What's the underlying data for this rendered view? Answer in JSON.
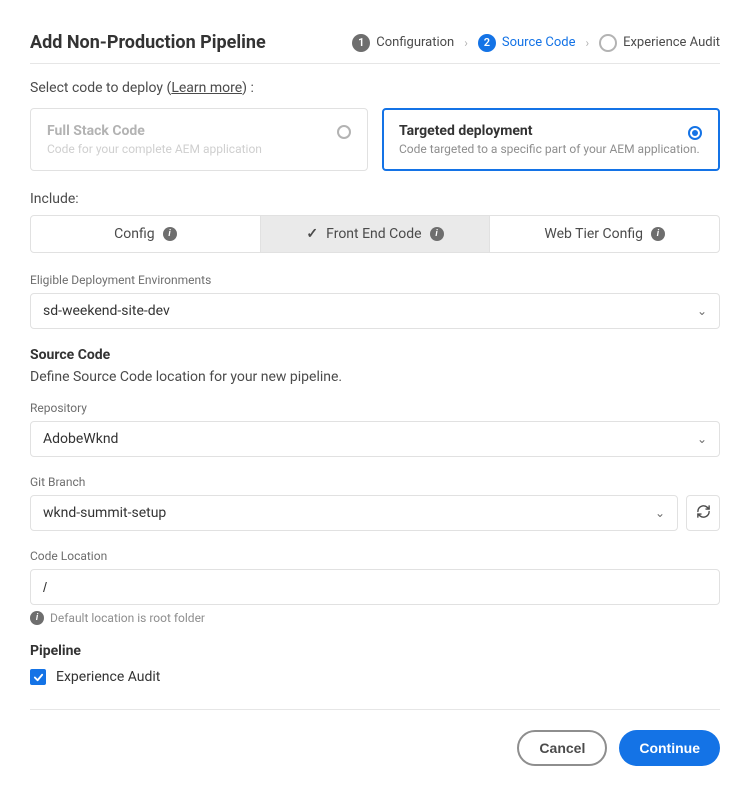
{
  "header": {
    "title": "Add Non-Production Pipeline",
    "steps": [
      {
        "num": "1",
        "label": "Configuration",
        "state": "done"
      },
      {
        "num": "2",
        "label": "Source Code",
        "state": "active"
      },
      {
        "num": "",
        "label": "Experience Audit",
        "state": "empty"
      }
    ]
  },
  "selectCode": {
    "label": "Select code to deploy",
    "learnMore": "Learn more",
    "suffix": " :"
  },
  "deployOptions": [
    {
      "title": "Full Stack Code",
      "desc": "Code for your complete AEM application",
      "selected": false
    },
    {
      "title": "Targeted deployment",
      "desc": "Code targeted to a specific part of your AEM application.",
      "selected": true
    }
  ],
  "include": {
    "label": "Include:",
    "tabs": [
      {
        "label": "Config",
        "selected": false
      },
      {
        "label": "Front End Code",
        "selected": true
      },
      {
        "label": "Web Tier Config",
        "selected": false
      }
    ]
  },
  "environment": {
    "label": "Eligible Deployment Environments",
    "value": "sd-weekend-site-dev"
  },
  "sourceCode": {
    "heading": "Source Code",
    "sub": "Define Source Code location for your new pipeline."
  },
  "repository": {
    "label": "Repository",
    "value": "AdobeWknd"
  },
  "gitBranch": {
    "label": "Git Branch",
    "value": "wknd-summit-setup"
  },
  "codeLocation": {
    "label": "Code Location",
    "value": "/",
    "hint": "Default location is root folder"
  },
  "pipeline": {
    "heading": "Pipeline",
    "checkboxLabel": "Experience Audit",
    "checked": true
  },
  "buttons": {
    "cancel": "Cancel",
    "continue": "Continue"
  }
}
